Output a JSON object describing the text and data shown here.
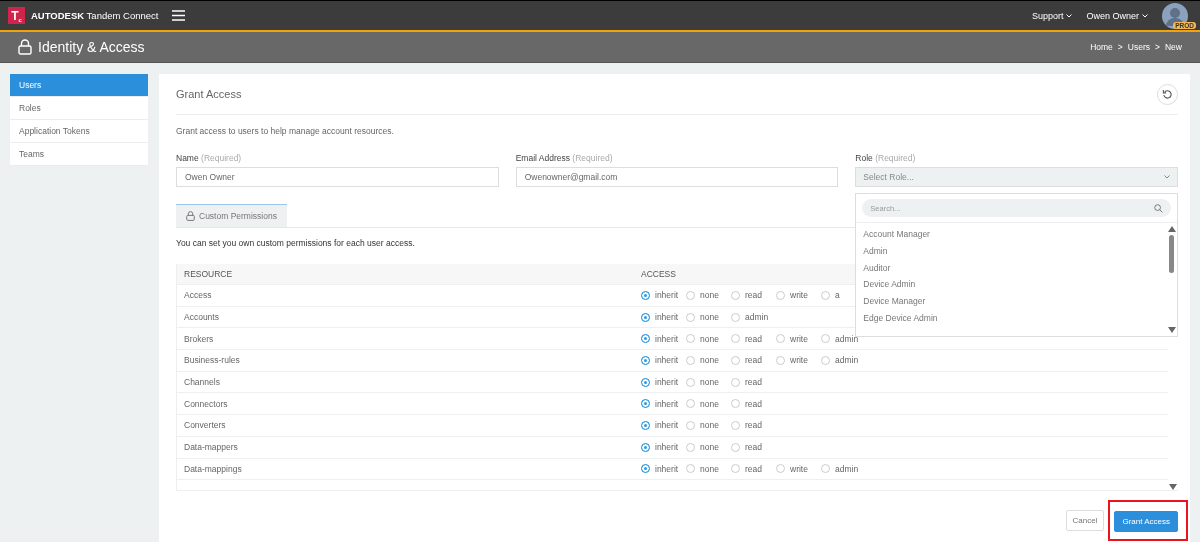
{
  "header": {
    "logo_letter": "T",
    "logo_sub": "c",
    "brand": "AUTODESK",
    "product": "Tandem Connect",
    "menus": [
      {
        "label": "Support"
      },
      {
        "label": "Owen Owner"
      }
    ],
    "env_badge": "PROD"
  },
  "page": {
    "title": "Identity & Access",
    "breadcrumb": [
      "Home",
      "Users",
      "New"
    ],
    "separator": ">"
  },
  "sidebar": {
    "items": [
      {
        "label": "Users",
        "selected": true
      },
      {
        "label": "Roles",
        "selected": false
      },
      {
        "label": "Application Tokens",
        "selected": false
      },
      {
        "label": "Teams",
        "selected": false
      }
    ]
  },
  "form": {
    "title": "Grant Access",
    "subtitle": "Grant access to users to help manage account resources.",
    "fields": [
      {
        "label": "Name",
        "hint": "(Required)",
        "value": "Owen Owner"
      },
      {
        "label": "Email Address",
        "hint": "(Required)",
        "value": "Owenowner@gmail.com"
      }
    ],
    "role": {
      "label": "Role",
      "hint": "(Required)",
      "placeholder": "Select Role...",
      "expanded": true,
      "search_placeholder": "Search...",
      "options": [
        "Account Manager",
        "Admin",
        "Auditor",
        "Device Admin",
        "Device Manager",
        "Edge Device Admin"
      ]
    }
  },
  "permissions": {
    "tab": "Custom Permissions",
    "description": "You can set you own custom permissions for each user access.",
    "columns": [
      "RESOURCE",
      "ACCESS"
    ],
    "rows": [
      {
        "resource": "Access",
        "options": [
          {
            "label": "inherit",
            "selected": true
          },
          {
            "label": "none",
            "selected": false
          },
          {
            "label": "read",
            "selected": false
          },
          {
            "label": "write",
            "selected": false
          },
          {
            "label": "a",
            "selected": false
          }
        ]
      },
      {
        "resource": "Accounts",
        "options": [
          {
            "label": "inherit",
            "selected": true
          },
          {
            "label": "none",
            "selected": false
          },
          {
            "label": "admin",
            "selected": false
          }
        ]
      },
      {
        "resource": "Brokers",
        "options": [
          {
            "label": "inherit",
            "selected": true
          },
          {
            "label": "none",
            "selected": false
          },
          {
            "label": "read",
            "selected": false
          },
          {
            "label": "write",
            "selected": false
          },
          {
            "label": "admin",
            "selected": false
          }
        ]
      },
      {
        "resource": "Business-rules",
        "options": [
          {
            "label": "inherit",
            "selected": true
          },
          {
            "label": "none",
            "selected": false
          },
          {
            "label": "read",
            "selected": false
          },
          {
            "label": "write",
            "selected": false
          },
          {
            "label": "admin",
            "selected": false
          }
        ]
      },
      {
        "resource": "Channels",
        "options": [
          {
            "label": "inherit",
            "selected": true
          },
          {
            "label": "none",
            "selected": false
          },
          {
            "label": "read",
            "selected": false
          }
        ]
      },
      {
        "resource": "Connectors",
        "options": [
          {
            "label": "inherit",
            "selected": true
          },
          {
            "label": "none",
            "selected": false
          },
          {
            "label": "read",
            "selected": false
          }
        ]
      },
      {
        "resource": "Converters",
        "options": [
          {
            "label": "inherit",
            "selected": true
          },
          {
            "label": "none",
            "selected": false
          },
          {
            "label": "read",
            "selected": false
          }
        ]
      },
      {
        "resource": "Data-mappers",
        "options": [
          {
            "label": "inherit",
            "selected": true
          },
          {
            "label": "none",
            "selected": false
          },
          {
            "label": "read",
            "selected": false
          }
        ]
      },
      {
        "resource": "Data-mappings",
        "options": [
          {
            "label": "inherit",
            "selected": true
          },
          {
            "label": "none",
            "selected": false
          },
          {
            "label": "read",
            "selected": false
          },
          {
            "label": "write",
            "selected": false
          },
          {
            "label": "admin",
            "selected": false
          }
        ]
      }
    ]
  },
  "actions": [
    {
      "label": "Cancel",
      "kind": "secondary",
      "highlighted": false
    },
    {
      "label": "Grant Access",
      "kind": "primary",
      "highlighted": true
    }
  ]
}
